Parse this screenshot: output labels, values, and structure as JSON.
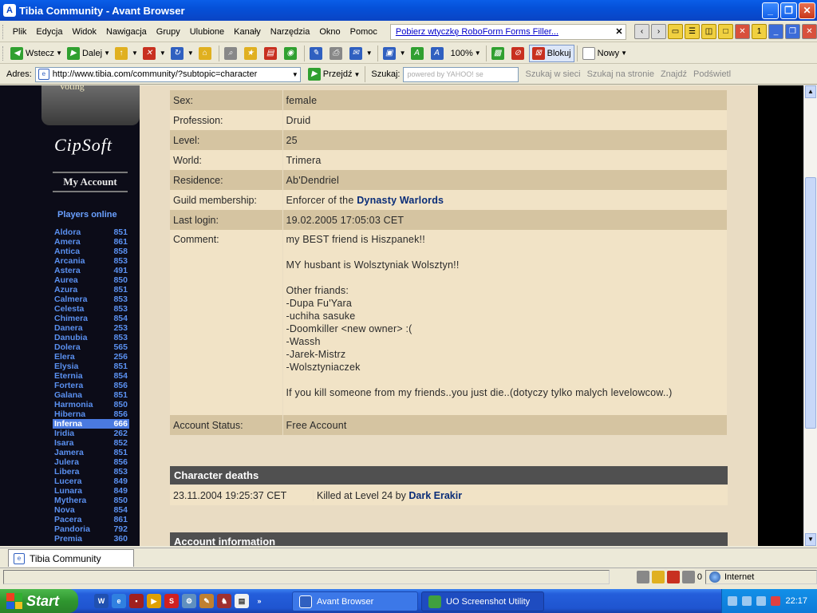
{
  "window": {
    "title": "Tibia Community - Avant Browser"
  },
  "menu": [
    "Plik",
    "Edycja",
    "Widok",
    "Nawigacja",
    "Grupy",
    "Ulubione",
    "Kanały",
    "Narzędzia",
    "Okno",
    "Pomoc"
  ],
  "robo_link": "Pobierz wtyczkę RoboForm Forms Filler...",
  "toolbar": {
    "back": "Wstecz",
    "forward": "Dalej",
    "zoom": "100%",
    "block": "Blokuj",
    "new": "Nowy"
  },
  "addressbar": {
    "label": "Adres:",
    "url": "http://www.tibia.com/community/?subtopic=character",
    "go": "Przejdź",
    "search_label": "Szukaj:",
    "search_placeholder": "powered by YAHOO! se",
    "web_search": "Szukaj w sieci",
    "page_search": "Szukaj na stronie",
    "find": "Znajdź",
    "highlight": "Podświetl"
  },
  "sidebar": {
    "voting": "Voting",
    "logo": "CipSoft",
    "my_account": "My Account",
    "players_online_title": "Players online",
    "worlds": [
      {
        "name": "Aldora",
        "count": "851"
      },
      {
        "name": "Amera",
        "count": "861"
      },
      {
        "name": "Antica",
        "count": "858"
      },
      {
        "name": "Arcania",
        "count": "853"
      },
      {
        "name": "Astera",
        "count": "491"
      },
      {
        "name": "Aurea",
        "count": "850"
      },
      {
        "name": "Azura",
        "count": "851"
      },
      {
        "name": "Calmera",
        "count": "853"
      },
      {
        "name": "Celesta",
        "count": "853"
      },
      {
        "name": "Chimera",
        "count": "854"
      },
      {
        "name": "Danera",
        "count": "253"
      },
      {
        "name": "Danubia",
        "count": "853"
      },
      {
        "name": "Dolera",
        "count": "565"
      },
      {
        "name": "Elera",
        "count": "256"
      },
      {
        "name": "Elysia",
        "count": "851"
      },
      {
        "name": "Eternia",
        "count": "854"
      },
      {
        "name": "Fortera",
        "count": "856"
      },
      {
        "name": "Galana",
        "count": "851"
      },
      {
        "name": "Harmonia",
        "count": "850"
      },
      {
        "name": "Hiberna",
        "count": "856"
      },
      {
        "name": "Inferna",
        "count": "666"
      },
      {
        "name": "Iridia",
        "count": "262"
      },
      {
        "name": "Isara",
        "count": "852"
      },
      {
        "name": "Jamera",
        "count": "851"
      },
      {
        "name": "Julera",
        "count": "856"
      },
      {
        "name": "Libera",
        "count": "853"
      },
      {
        "name": "Lucera",
        "count": "849"
      },
      {
        "name": "Lunara",
        "count": "849"
      },
      {
        "name": "Mythera",
        "count": "850"
      },
      {
        "name": "Nova",
        "count": "854"
      },
      {
        "name": "Pacera",
        "count": "861"
      },
      {
        "name": "Pandoria",
        "count": "792"
      },
      {
        "name": "Premia",
        "count": "360"
      }
    ],
    "selected_world": "Inferna"
  },
  "character": {
    "sex_label": "Sex:",
    "sex": "female",
    "profession_label": "Profession:",
    "profession": "Druid",
    "level_label": "Level:",
    "level": "25",
    "world_label": "World:",
    "world": "Trimera",
    "residence_label": "Residence:",
    "residence": "Ab'Dendriel",
    "guild_label": "Guild membership:",
    "guild_prefix": "Enforcer of the",
    "guild_name": "Dynasty Warlords",
    "lastlogin_label": "Last login:",
    "lastlogin": "19.02.2005 17:05:03 CET",
    "comment_label": "Comment:",
    "comment_lines": [
      "my BEST friend is Hiszpanek!!",
      "",
      "MY husbant is Wolsztyniak Wolsztyn!!",
      "",
      "Other friands:",
      "-Dupa Fu'Yara",
      "-uchiha sasuke",
      "-Doomkiller <new owner> :(",
      "-Wassh",
      "-Jarek-Mistrz",
      "-Wolsztyniaczek",
      "",
      "If you kill someone from my friends..you just die..(dotyczy tylko malych levelowcow..)"
    ],
    "status_label": "Account Status:",
    "status": "Free Account"
  },
  "deaths": {
    "title": "Character deaths",
    "date": "23.11.2004 19:25:37 CET",
    "text_prefix": "Killed at Level 24 by",
    "killer": "Dark Erakir"
  },
  "account_info_title": "Account information",
  "tab": {
    "label": "Tibia Community"
  },
  "status": {
    "count": "0",
    "zone": "Internet"
  },
  "taskbar": {
    "start": "Start",
    "task1": "Avant Browser",
    "task2": "UO Screenshot Utility",
    "clock": "22:17"
  }
}
